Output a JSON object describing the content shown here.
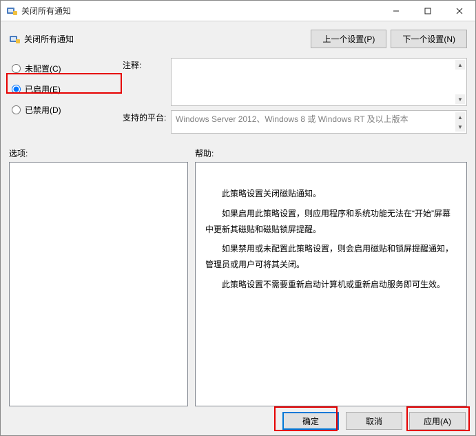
{
  "window": {
    "title": "关闭所有通知"
  },
  "header": {
    "policy_title": "关闭所有通知",
    "prev_button": "上一个设置(P)",
    "next_button": "下一个设置(N)"
  },
  "radios": {
    "not_configured": "未配置(C)",
    "enabled": "已启用(E)",
    "disabled": "已禁用(D)",
    "selected": "enabled"
  },
  "info": {
    "comment_label": "注释:",
    "comment_value": "",
    "platform_label": "支持的平台:",
    "platform_value": "Windows Server 2012、Windows 8 或 Windows RT 及以上版本"
  },
  "panels": {
    "options_label": "选项:",
    "help_label": "帮助:",
    "help_paragraphs": [
      "此策略设置关闭磁贴通知。",
      "如果启用此策略设置，则应用程序和系统功能无法在“开始”屏幕中更新其磁贴和磁贴锁屏提醒。",
      "如果禁用或未配置此策略设置，则会启用磁贴和锁屏提醒通知，管理员或用户可将其关闭。",
      "此策略设置不需要重新启动计算机或重新启动服务即可生效。"
    ]
  },
  "footer": {
    "ok": "确定",
    "cancel": "取消",
    "apply": "应用(A)"
  }
}
